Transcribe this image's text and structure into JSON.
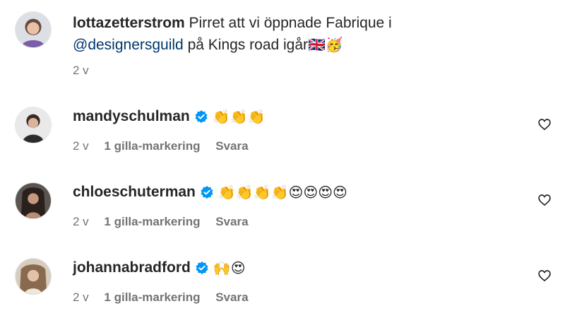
{
  "post": {
    "username": "lottazetterstrom",
    "text_before_mention": " Pirret att vi öppnade Fabrique i",
    "mention": "@designersguild",
    "text_after_mention": " på Kings road igår",
    "emojis": "🇬🇧🥳",
    "time": "2 v"
  },
  "comments": [
    {
      "username": "mandyschulman",
      "emojis": "👏👏👏",
      "time": "2 v",
      "likes": "1 gilla-markering",
      "reply_label": "Svara"
    },
    {
      "username": "chloeschuterman",
      "emojis": "👏👏👏👏😍😍😍😍",
      "time": "2 v",
      "likes": "1 gilla-markering",
      "reply_label": "Svara"
    },
    {
      "username": "johannabradford",
      "emojis": "🙌😍",
      "time": "2 v",
      "likes": "1 gilla-markering",
      "reply_label": "Svara"
    }
  ],
  "icons": {
    "verified": "verified-badge-icon",
    "like": "heart-icon"
  },
  "colors": {
    "verified_blue": "#0095f6",
    "mention_blue": "#00376b",
    "meta_gray": "#737373"
  }
}
